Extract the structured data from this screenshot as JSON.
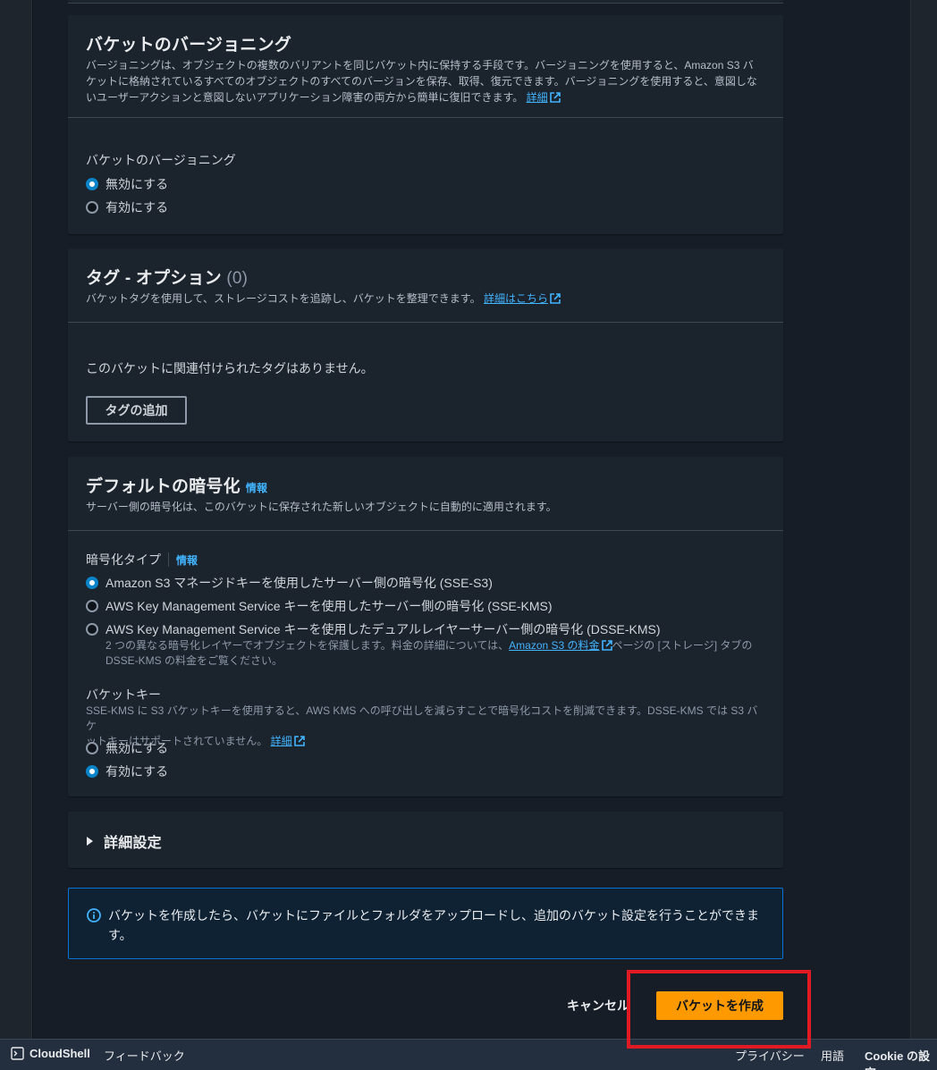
{
  "versioning": {
    "title": "バケットのバージョニング",
    "desc_1": "バージョニングは、オブジェクトの複数のバリアントを同じバケット内に保持する手段です。バージョニングを使用すると、Amazon S3 バ",
    "desc_2": "ケットに格納されているすべてのオブジェクトのすべてのバージョンを保存、取得、復元できます。バージョニングを使用すると、意図しな",
    "desc_3": "いユーザーアクションと意図しないアプリケーション障害の両方から簡単に復旧できます。",
    "learn_more": "詳細",
    "field_label": "バケットのバージョニング",
    "opt_disable": "無効にする",
    "opt_enable": "有効にする"
  },
  "tags": {
    "title": "タグ - オプション",
    "count": "(0)",
    "desc": "バケットタグを使用して、ストレージコストを追跡し、バケットを整理できます。",
    "learn_more": "詳細はこちら",
    "empty": "このバケットに関連付けられたタグはありません。",
    "add_button": "タグの追加"
  },
  "encryption": {
    "title": "デフォルトの暗号化",
    "info": "情報",
    "desc": "サーバー側の暗号化は、このバケットに保存された新しいオブジェクトに自動的に適用されます。",
    "type_label": "暗号化タイプ",
    "type_info": "情報",
    "opt_sse_s3": "Amazon S3 マネージドキーを使用したサーバー側の暗号化 (SSE-S3)",
    "opt_sse_kms": "AWS Key Management Service キーを使用したサーバー側の暗号化 (SSE-KMS)",
    "opt_dsse_kms": "AWS Key Management Service キーを使用したデュアルレイヤーサーバー側の暗号化 (DSSE-KMS)",
    "dsse_desc_1": "2 つの異なる暗号化レイヤーでオブジェクトを保護します。料金の詳細については、",
    "dsse_link": "Amazon S3 の料金",
    "dsse_desc_2": "ページの [ストレージ] タブの",
    "dsse_desc_3": "DSSE-KMS の料金をご覧ください。",
    "bucket_key_label": "バケットキー",
    "bucket_key_desc_1": "SSE-KMS に S3 バケットキーを使用すると、AWS KMS への呼び出しを減らすことで暗号化コストを削減できます。DSSE-KMS では S3 バケ",
    "bucket_key_desc_2": "ットキーはサポートされていません。",
    "bucket_key_learn_more": "詳細",
    "bk_disable": "無効にする",
    "bk_enable": "有効にする"
  },
  "advanced": {
    "title": "詳細設定"
  },
  "alert": {
    "text_1": "バケットを作成したら、バケットにファイルとフォルダをアップロードし、追加のバケット設定を行うことができま",
    "text_2": "す。"
  },
  "actions": {
    "cancel": "キャンセル",
    "create": "バケットを作成"
  },
  "footer": {
    "cloudshell": "CloudShell",
    "feedback": "フィードバック",
    "privacy": "プライバシー",
    "terms": "用語",
    "cookie": "Cookie の設定"
  },
  "colors": {
    "accent_link": "#42b4ff",
    "primary": "#ff9900",
    "highlight_box": "#e01a22",
    "radio_selected": "#0a84c8"
  }
}
